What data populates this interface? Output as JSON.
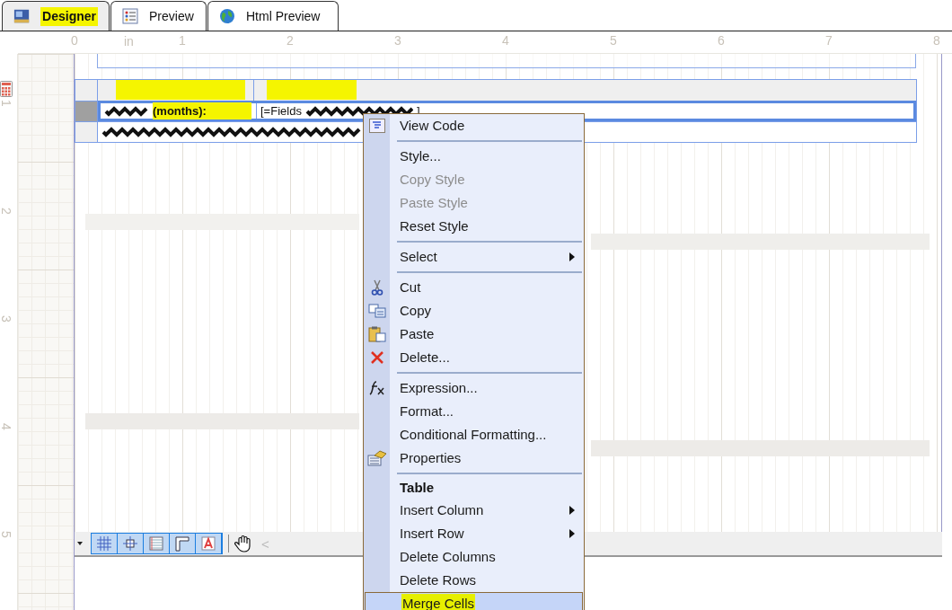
{
  "tabs": [
    {
      "label": "Designer",
      "selected": true,
      "highlighted": true
    },
    {
      "label": "Preview",
      "selected": false,
      "highlighted": false
    },
    {
      "label": "Html Preview",
      "selected": false,
      "highlighted": false
    }
  ],
  "ruler": {
    "unit": "in",
    "top_marks": [
      "0",
      "1",
      "2",
      "3",
      "4",
      "5",
      "6",
      "7",
      "8"
    ],
    "side_marks": [
      "1",
      "2",
      "3",
      "4",
      "5"
    ]
  },
  "table": {
    "rows": [
      {
        "kind": "header",
        "cells": [
          {
            "text": "",
            "highlighted": true
          },
          {
            "text": "",
            "highlighted": true
          }
        ]
      },
      {
        "kind": "detail",
        "selected": true,
        "cells": [
          {
            "text": "(months):",
            "highlighted": true
          },
          {
            "text": "[=Fields",
            "suffix": "]",
            "highlighted": false
          }
        ]
      },
      {
        "kind": "footer",
        "cells": [
          {
            "text": ""
          }
        ]
      }
    ]
  },
  "context_menu": {
    "items": [
      {
        "kind": "item",
        "label": "View Code",
        "disabled": false,
        "submenu": false,
        "selected": false
      },
      {
        "kind": "separator"
      },
      {
        "kind": "item",
        "label": "Style...",
        "disabled": false,
        "submenu": false,
        "selected": false
      },
      {
        "kind": "item",
        "label": "Copy Style",
        "disabled": true,
        "submenu": false,
        "selected": false
      },
      {
        "kind": "item",
        "label": "Paste Style",
        "disabled": true,
        "submenu": false,
        "selected": false
      },
      {
        "kind": "item",
        "label": "Reset Style",
        "disabled": false,
        "submenu": false,
        "selected": false
      },
      {
        "kind": "separator"
      },
      {
        "kind": "item",
        "label": "Select",
        "disabled": false,
        "submenu": true,
        "selected": false
      },
      {
        "kind": "separator"
      },
      {
        "kind": "item",
        "label": "Cut",
        "disabled": false,
        "submenu": false,
        "selected": false
      },
      {
        "kind": "item",
        "label": "Copy",
        "disabled": false,
        "submenu": false,
        "selected": false
      },
      {
        "kind": "item",
        "label": "Paste",
        "disabled": false,
        "submenu": false,
        "selected": false
      },
      {
        "kind": "item",
        "label": "Delete...",
        "disabled": false,
        "submenu": false,
        "selected": false
      },
      {
        "kind": "separator"
      },
      {
        "kind": "item",
        "label": "Expression...",
        "disabled": false,
        "submenu": false,
        "selected": false
      },
      {
        "kind": "item",
        "label": "Format...",
        "disabled": false,
        "submenu": false,
        "selected": false
      },
      {
        "kind": "item",
        "label": "Conditional Formatting...",
        "disabled": false,
        "submenu": false,
        "selected": false
      },
      {
        "kind": "item",
        "label": "Properties",
        "disabled": false,
        "submenu": false,
        "selected": false
      },
      {
        "kind": "separator"
      },
      {
        "kind": "header",
        "label": "Table"
      },
      {
        "kind": "item",
        "label": "Insert Column",
        "disabled": false,
        "submenu": true,
        "selected": false
      },
      {
        "kind": "item",
        "label": "Insert Row",
        "disabled": false,
        "submenu": true,
        "selected": false
      },
      {
        "kind": "item",
        "label": "Delete Columns",
        "disabled": false,
        "submenu": false,
        "selected": false
      },
      {
        "kind": "item",
        "label": "Delete Rows",
        "disabled": false,
        "submenu": false,
        "selected": false
      },
      {
        "kind": "item",
        "label": "Merge Cells",
        "disabled": false,
        "submenu": false,
        "selected": true,
        "highlighted": true
      }
    ]
  },
  "toolbar": {
    "back": "<"
  }
}
